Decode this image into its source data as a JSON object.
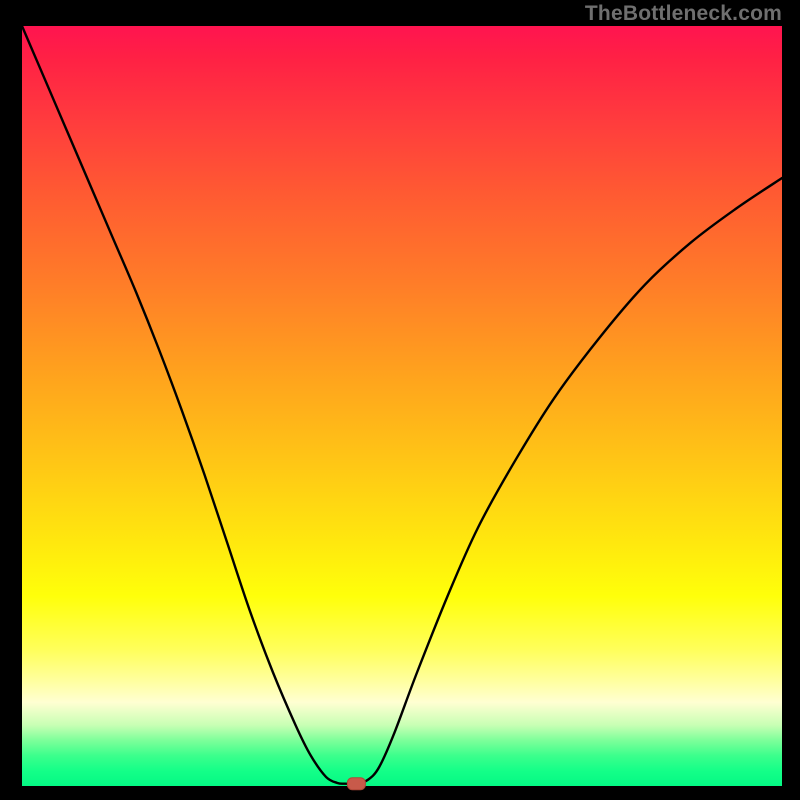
{
  "watermark": "TheBottleneck.com",
  "chart_data": {
    "type": "line",
    "title": "",
    "xlabel": "",
    "ylabel": "",
    "xlim": [
      0,
      1
    ],
    "ylim": [
      0,
      1
    ],
    "series": [
      {
        "name": "curve",
        "x": [
          0.0,
          0.03,
          0.06,
          0.09,
          0.12,
          0.15,
          0.18,
          0.21,
          0.24,
          0.27,
          0.3,
          0.33,
          0.36,
          0.38,
          0.4,
          0.415,
          0.425,
          0.44,
          0.455,
          0.47,
          0.49,
          0.52,
          0.56,
          0.6,
          0.65,
          0.7,
          0.76,
          0.82,
          0.88,
          0.94,
          1.0
        ],
        "y": [
          1.0,
          0.93,
          0.86,
          0.79,
          0.72,
          0.65,
          0.575,
          0.495,
          0.41,
          0.32,
          0.23,
          0.15,
          0.08,
          0.04,
          0.012,
          0.004,
          0.003,
          0.003,
          0.008,
          0.025,
          0.07,
          0.15,
          0.25,
          0.34,
          0.43,
          0.51,
          0.59,
          0.66,
          0.715,
          0.76,
          0.8
        ]
      }
    ],
    "marker": {
      "x": 0.44,
      "y": 0.003
    },
    "gradient_stops": [
      {
        "pos": 0.0,
        "color": "#ff1450"
      },
      {
        "pos": 0.5,
        "color": "#ffc815"
      },
      {
        "pos": 0.8,
        "color": "#ffff0a"
      },
      {
        "pos": 1.0,
        "color": "#04f884"
      }
    ]
  }
}
